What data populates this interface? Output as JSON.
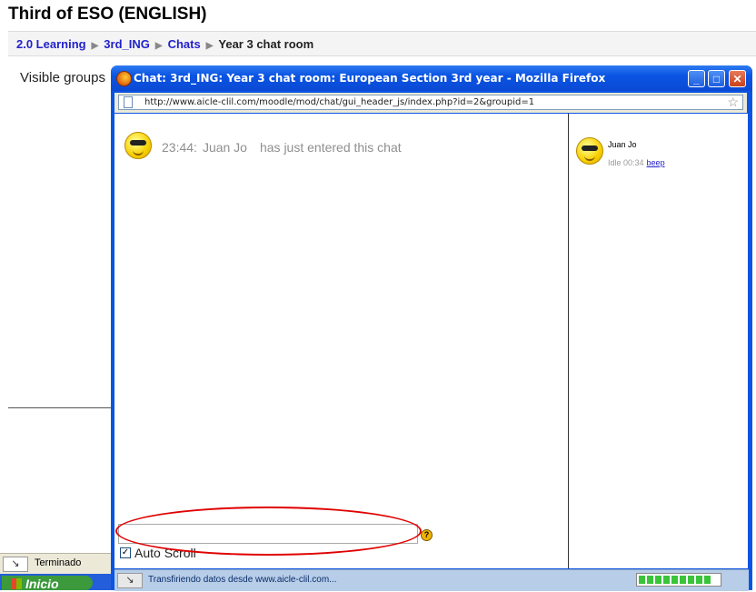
{
  "page": {
    "title": "Third of ESO (ENGLISH)",
    "breadcrumb": [
      "2.0 Learning",
      "3rd_ING",
      "Chats",
      "Year 3 chat room"
    ],
    "visible_groups_label": "Visible groups"
  },
  "background_status": {
    "text": "Terminado"
  },
  "taskbar": {
    "start_label": "Inicio"
  },
  "popup": {
    "title": "Chat: 3rd_ING: Year 3 chat room: European Section 3rd year - Mozilla Firefox",
    "url": "http://www.aicle-clil.com/moodle/mod/chat/gui_header_js/index.php?id=2&groupid=1",
    "window_buttons": {
      "minimize": "_",
      "maximize": "□",
      "close": "✕"
    },
    "messages": [
      {
        "time": "23:44:",
        "user": "Juan Jo",
        "text": "has just entered this chat"
      }
    ],
    "users": [
      {
        "name": "Juan Jo",
        "idle": "Idle 00:34",
        "beep": "beep"
      }
    ],
    "input": {
      "value": "",
      "help": "?"
    },
    "auto_scroll": {
      "label": "Auto Scroll",
      "checked": true,
      "mark": "✓"
    },
    "status": {
      "text": "Transfiriendo datos desde www.aicle-clil.com...",
      "progress": 0.9
    }
  }
}
